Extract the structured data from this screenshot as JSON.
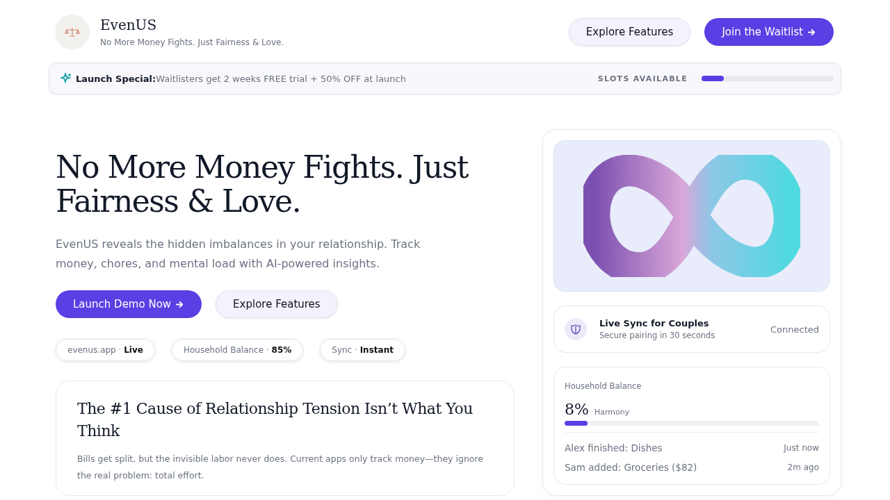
{
  "brand": {
    "name": "EvenUS",
    "tagline": "No More Money Fights. Just Fairness & Love."
  },
  "nav_buttons": [
    {
      "label": "Explore Features",
      "kind": "secondary",
      "arrow": false
    },
    {
      "label": "Join the Waitlist",
      "kind": "primary",
      "arrow": true
    }
  ],
  "banner": {
    "title": "Launch Special:",
    "text": "Waitlisters get 2 weeks FREE trial + 50% OFF at launch",
    "meter_label": "SLOTS AVAILABLE",
    "level": 0.17
  },
  "hero": {
    "title": "No More Money Fights. Just Fairness & Love.",
    "text": "EvenUS reveals the hidden imbalances in your relationship. Track money, chores, and mental load with AI-powered insights.",
    "buttons": [
      {
        "label": "Launch Demo Now",
        "kind": "primary",
        "arrow": true
      },
      {
        "label": "Explore Features",
        "kind": "secondary",
        "arrow": false
      }
    ],
    "chips": [
      {
        "label": "evenus.app",
        "separator": "·",
        "value": "Live"
      },
      {
        "label": "Household Balance",
        "separator": "·",
        "value": "85%"
      },
      {
        "label": "Sync",
        "separator": "·",
        "value": "Instant"
      }
    ]
  },
  "problem_card": {
    "title": "The #1 Cause of Relationship Tension Isn’t What You Think",
    "text": "Bills get split, but the invisible labor never does. Current apps only track money—they ignore the real problem: total effort."
  },
  "sync_card": {
    "title": "Live Sync for Couples",
    "subtitle": "Secure pairing in 30 seconds",
    "status": "Connected"
  },
  "balance_card": {
    "title": "Household Balance",
    "value": "8%",
    "label": "Harmony",
    "level": 0.09,
    "activity": [
      {
        "text": "Alex finished: Dishes",
        "time": "Just now"
      },
      {
        "text": "Sam added: Groceries ($82)",
        "time": "2m ago"
      }
    ]
  }
}
